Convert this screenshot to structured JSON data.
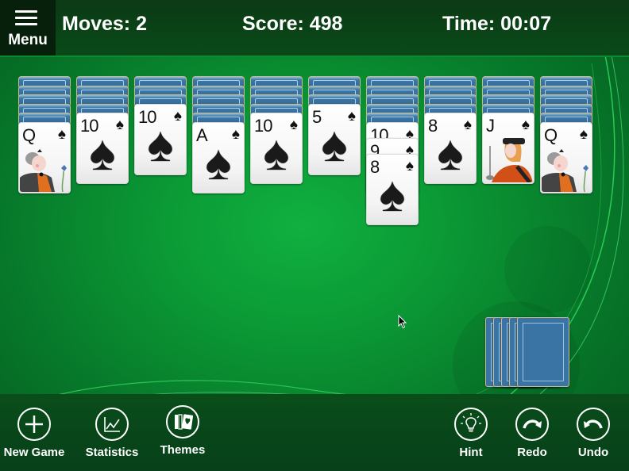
{
  "header": {
    "menu_label": "Menu",
    "moves": "Moves: 2",
    "score": "Score: 498",
    "time": "Time: 00:07"
  },
  "tableau": [
    {
      "face_down": 5,
      "face_up": [
        {
          "rank": "Q",
          "suit": "spades",
          "suit_glyph": "♠",
          "face_card": "queen"
        }
      ]
    },
    {
      "face_down": 4,
      "face_up": [
        {
          "rank": "10",
          "suit": "spades",
          "suit_glyph": "♠"
        }
      ]
    },
    {
      "face_down": 3,
      "face_up": [
        {
          "rank": "10",
          "suit": "spades",
          "suit_glyph": "♠"
        }
      ]
    },
    {
      "face_down": 5,
      "face_up": [
        {
          "rank": "A",
          "suit": "spades",
          "suit_glyph": "♠"
        }
      ]
    },
    {
      "face_down": 4,
      "face_up": [
        {
          "rank": "10",
          "suit": "spades",
          "suit_glyph": "♠"
        }
      ]
    },
    {
      "face_down": 3,
      "face_up": [
        {
          "rank": "5",
          "suit": "spades",
          "suit_glyph": "♠"
        }
      ]
    },
    {
      "face_down": 5,
      "face_up": [
        {
          "rank": "10",
          "suit": "spades",
          "suit_glyph": "♠"
        },
        {
          "rank": "9",
          "suit": "spades",
          "suit_glyph": "♠"
        },
        {
          "rank": "8",
          "suit": "spades",
          "suit_glyph": "♠"
        }
      ]
    },
    {
      "face_down": 4,
      "face_up": [
        {
          "rank": "8",
          "suit": "spades",
          "suit_glyph": "♠"
        }
      ]
    },
    {
      "face_down": 4,
      "face_up": [
        {
          "rank": "J",
          "suit": "spades",
          "suit_glyph": "♠",
          "face_card": "jack"
        }
      ]
    },
    {
      "face_down": 5,
      "face_up": [
        {
          "rank": "Q",
          "suit": "spades",
          "suit_glyph": "♠",
          "face_card": "queen"
        }
      ]
    }
  ],
  "stock": {
    "remaining_deals": 5
  },
  "toolbar": {
    "left": [
      {
        "id": "new-game",
        "label": "New Game",
        "icon": "plus-icon"
      },
      {
        "id": "statistics",
        "label": "Statistics",
        "icon": "chart-line-icon"
      },
      {
        "id": "themes",
        "label": "Themes",
        "icon": "cards-icon"
      }
    ],
    "right": [
      {
        "id": "hint",
        "label": "Hint",
        "icon": "lightbulb-icon"
      },
      {
        "id": "redo",
        "label": "Redo",
        "icon": "redo-icon"
      },
      {
        "id": "undo",
        "label": "Undo",
        "icon": "undo-icon"
      }
    ]
  },
  "colors": {
    "felt": "#0b9a35",
    "header_bg": "#0a4a19",
    "menu_bg": "#06200b",
    "card_back": "#3a74a4",
    "text": "#ffffff"
  }
}
